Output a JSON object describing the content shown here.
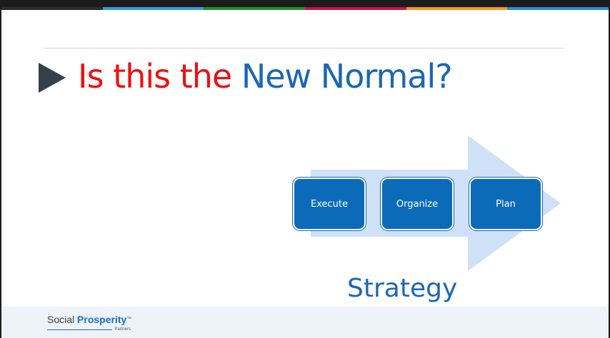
{
  "colors": {
    "title_red": "#ee1111",
    "title_blue": "#1b66b6",
    "box_blue": "#0b6bb8",
    "arrow_light_blue": "#cfe1f6",
    "footer_bg": "#eef2f9",
    "top_bar_segments": [
      "#2b2b2b",
      "#2aa0dd",
      "#1e8f2e",
      "#c8154f",
      "#f49a1e",
      "#2a8fd6"
    ]
  },
  "slide": {
    "title_part1": "Is this the",
    "title_part2": "New Normal?",
    "bullet_icon": "right-triangle-bullet-icon"
  },
  "diagram": {
    "arrow_icon": "chevron-arrow-icon",
    "steps": [
      "Execute",
      "Organize",
      "Plan"
    ],
    "caption": "Strategy"
  },
  "footer": {
    "logo_word1": "Social ",
    "logo_word2": "Prosperity",
    "logo_tm": "™",
    "logo_sub": "Partners"
  }
}
